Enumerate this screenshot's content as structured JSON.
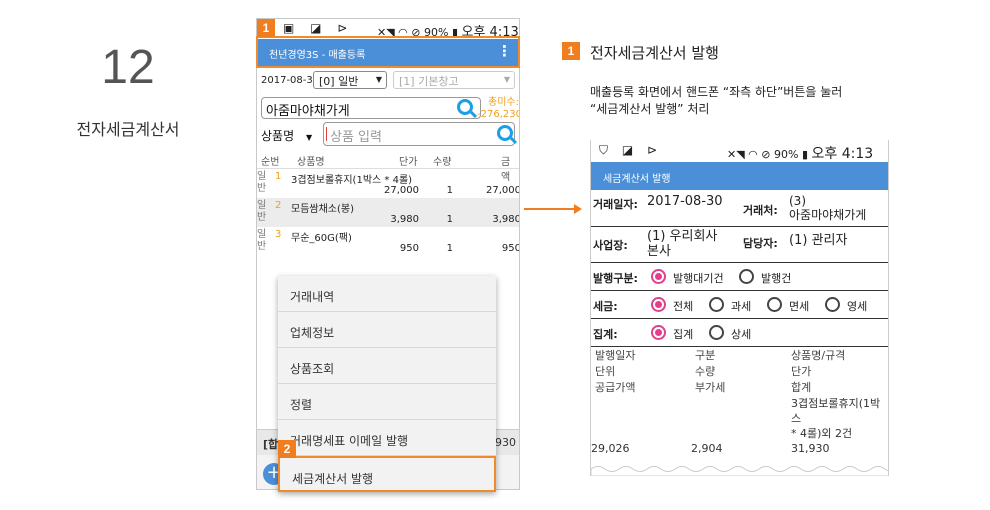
{
  "step": {
    "number": "12",
    "title": "전자세금계산서"
  },
  "phone1": {
    "status": {
      "icons_left": "▣ ◪ ⊳",
      "battery": "90%",
      "time": "오후 4:13"
    },
    "appbar": {
      "title": "천년경영3S - 매출등록",
      "menu_icon": "⋮"
    },
    "badge1": "1",
    "date": "2017-08-30",
    "type_select": "[0] 일반",
    "warehouse_select": "[1] 기본창고",
    "customer": "아줌마야채가게",
    "unpaid_label": "총미수:",
    "unpaid_value": "-276,230",
    "product_field_select": "상품명",
    "product_placeholder": "상품 입력",
    "table": {
      "headers": {
        "no": "순번",
        "name": "상품명",
        "price": "단가",
        "qty": "수량",
        "amount": "금액"
      },
      "rows": [
        {
          "side": "일반",
          "no": "1",
          "name": "3겹점보롤휴지(1박스 * 4롤)",
          "price": "27,000",
          "qty": "1",
          "amount": "27,000"
        },
        {
          "side": "일반",
          "no": "2",
          "name": "모듬쌈채소(봉)",
          "price": "3,980",
          "qty": "1",
          "amount": "3,980"
        },
        {
          "side": "일반",
          "no": "3",
          "name": "무순_60G(팩)",
          "price": "950",
          "qty": "1",
          "amount": "950"
        }
      ]
    },
    "bottom_left": "[합",
    "bottom_right": "930",
    "plus": "+"
  },
  "menu": {
    "badge2": "2",
    "items": [
      "거래내역",
      "업체정보",
      "상품조회",
      "정렬",
      "거래명세표 이메일 발행",
      "세금계산서 발행"
    ]
  },
  "desc": {
    "badge": "1",
    "title": "전자세금계산서 발행",
    "line1": "매출등록 화면에서 핸드폰 “좌측 하단”버튼을 눌러",
    "line2": "“세금계산서 발행” 처리"
  },
  "phone2": {
    "status": {
      "icons_left": "⛉ ◪ ⊳",
      "battery": "90%",
      "time": "오후 4:13"
    },
    "appbar_title": "세금계산서 발행",
    "trade_date_label": "거래일자:",
    "trade_date": "2017-08-30",
    "partner_label": "거래처:",
    "partner_code": "(3)",
    "partner_name": "아줌마야채가게",
    "biz_label": "사업장:",
    "biz_value1": "(1) 우리회사",
    "biz_value2": "본사",
    "manager_label": "담당자:",
    "manager_value": "(1) 관리자",
    "issue_label": "발행구분:",
    "issue_opt1": "발행대기건",
    "issue_opt2": "발행건",
    "tax_label": "세금:",
    "tax_opts": [
      "전체",
      "과세",
      "면세",
      "영세"
    ],
    "sum_label": "집계:",
    "sum_opt1": "집계",
    "sum_opt2": "상세",
    "grid": {
      "col1": [
        "발행일자",
        "단위",
        "공급가액"
      ],
      "col2": [
        "구분",
        "수량",
        "부가세"
      ],
      "col3": [
        "상품명/규격",
        "단가",
        "합계"
      ],
      "item_line1": "3겹점보롤휴지(1박스",
      "item_line2": "* 4롤)외 2건",
      "supply": "29,026",
      "vat": "2,904",
      "total": "31,930"
    }
  }
}
